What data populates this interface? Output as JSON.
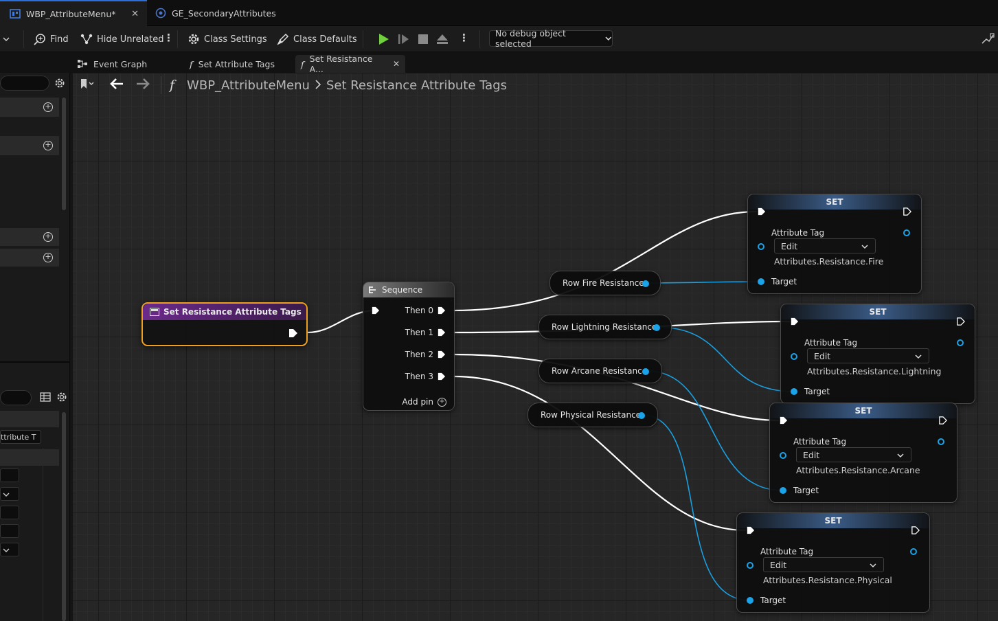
{
  "doc_tabs": [
    {
      "label": "WBP_AttributeMenu*",
      "icon": "widget-blueprint-icon",
      "active": true
    },
    {
      "label": "GE_SecondaryAttributes",
      "icon": "gameplay-effect-icon",
      "active": false
    }
  ],
  "toolbar": {
    "find": "Find",
    "hide_unrelated": "Hide Unrelated",
    "class_settings": "Class Settings",
    "class_defaults": "Class Defaults",
    "debug_object": "No debug object selected",
    "play_color": "#6fcf3c"
  },
  "graph_tabs": [
    {
      "label": "Event Graph",
      "icon": "event-graph-icon"
    },
    {
      "label": "Set Attribute Tags",
      "icon": "function-icon"
    },
    {
      "label": "Set Resistance A...",
      "icon": "function-icon",
      "active": true
    }
  ],
  "left_panel": {
    "attr_field": "ttribute T"
  },
  "breadcrumb": {
    "root": "WBP_AttributeMenu",
    "current": "Set Resistance Attribute Tags"
  },
  "entry_node": {
    "title": "Set Resistance Attribute Tags",
    "color": "#6b2a8a"
  },
  "sequence_node": {
    "title": "Sequence",
    "pins": [
      "Then 0",
      "Then 1",
      "Then 2",
      "Then 3"
    ],
    "add_pin": "Add pin"
  },
  "variable_nodes": [
    {
      "label": "Row Fire Resistance"
    },
    {
      "label": "Row Lightning Resistance"
    },
    {
      "label": "Row Arcane Resistance"
    },
    {
      "label": "Row Physical Resistance"
    }
  ],
  "set_nodes": [
    {
      "title": "SET",
      "attr_label": "Attribute Tag",
      "edit": "Edit",
      "tag": "Attributes.Resistance.Fire",
      "target": "Target"
    },
    {
      "title": "SET",
      "attr_label": "Attribute Tag",
      "edit": "Edit",
      "tag": "Attributes.Resistance.Lightning",
      "target": "Target"
    },
    {
      "title": "SET",
      "attr_label": "Attribute Tag",
      "edit": "Edit",
      "tag": "Attributes.Resistance.Arcane",
      "target": "Target"
    },
    {
      "title": "SET",
      "attr_label": "Attribute Tag",
      "edit": "Edit",
      "tag": "Attributes.Resistance.Physical",
      "target": "Target"
    }
  ],
  "colors": {
    "exec_wire": "#ffffff",
    "object_pin": "#1aa3e8",
    "selection": "#f0a020"
  }
}
